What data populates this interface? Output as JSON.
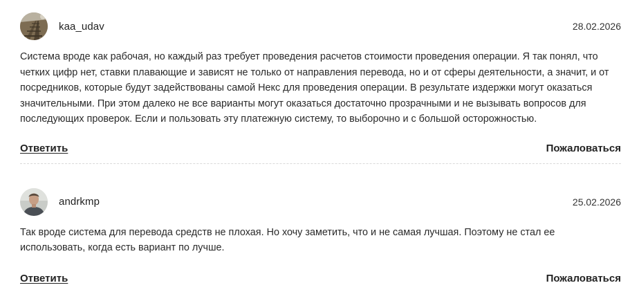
{
  "comments": [
    {
      "author": "kaa_udav",
      "date": "28.02.2026",
      "avatar_icon": "avatar-railway-photo",
      "text": "Система вроде как рабочая, но каждый раз требует проведения расчетов стоимости проведения операции. Я так понял, что четких цифр нет, ставки плавающие и зависят не только от направления перевода, но и от сферы деятельности, а значит, и от посредников, которые будут задействованы самой Некс для проведения операции. В результате издержки могут оказаться значительными. При этом далеко не все варианты могут оказаться достаточно прозрачными и не вызывать вопросов для последующих проверок. Если и пользовать эту платежную систему, то выборочно и с большой осторожностью.",
      "reply_label": "Ответить",
      "report_label": "Пожаловаться"
    },
    {
      "author": "andrkmp",
      "date": "25.02.2026",
      "avatar_icon": "avatar-person-photo",
      "text": "Так вроде система для перевода средств не плохая. Но хочу заметить, что и не самая лучшая. Поэтому не стал ее использовать, когда есть вариант по лучше.",
      "reply_label": "Ответить",
      "report_label": "Пожаловаться"
    }
  ]
}
